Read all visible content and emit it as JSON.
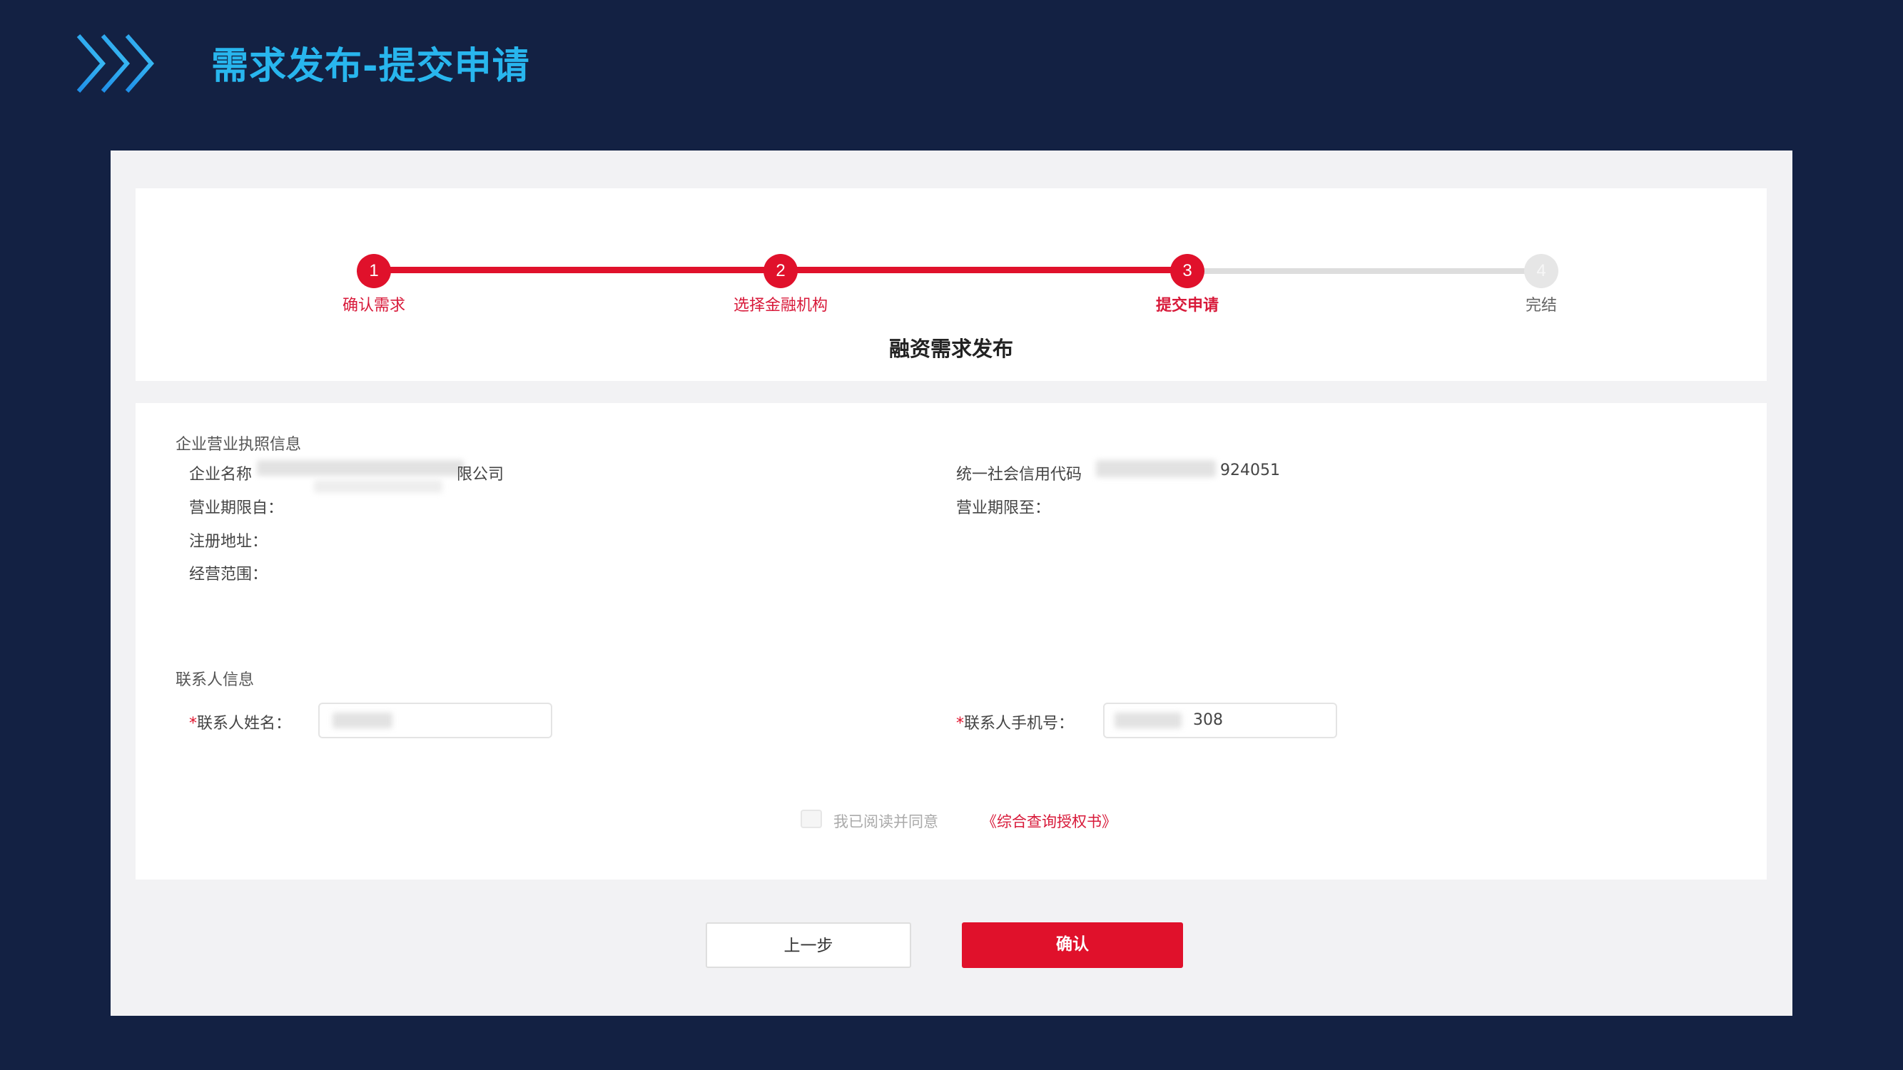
{
  "slide": {
    "title": "需求发布-提交申请",
    "accent_color": "#28b6ee",
    "background_color": "#132143"
  },
  "steps": [
    {
      "number": "1",
      "label": "确认需求",
      "state": "done"
    },
    {
      "number": "2",
      "label": "选择金融机构",
      "state": "done"
    },
    {
      "number": "3",
      "label": "提交申请",
      "state": "active"
    },
    {
      "number": "4",
      "label": "完结",
      "state": "todo"
    }
  ],
  "form_title": "融资需求发布",
  "license": {
    "section_title": "企业营业执照信息",
    "company_name_label": "企业名称",
    "company_name_suffix": "限公司",
    "credit_code_label": "统一社会信用代码",
    "credit_code_suffix": "924051",
    "period_start_label": "营业期限自：",
    "period_end_label": "营业期限至：",
    "address_label": "注册地址：",
    "scope_label": "经营范围："
  },
  "contact": {
    "section_title": "联系人信息",
    "required_mark": "*",
    "name_label": "联系人姓名：",
    "phone_label": "联系人手机号：",
    "phone_suffix": "308"
  },
  "agreement": {
    "text": "我已阅读并同意",
    "link": "《综合查询授权书》"
  },
  "buttons": {
    "prev": "上一步",
    "confirm": "确认"
  },
  "theme": {
    "primary_red": "#e0112b"
  }
}
